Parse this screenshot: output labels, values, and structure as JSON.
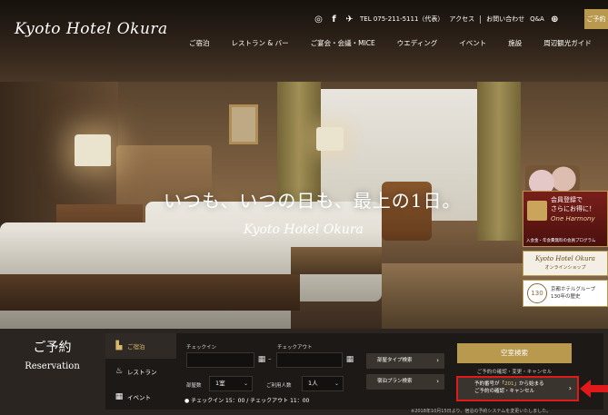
{
  "header": {
    "logo_text": "Kyoto Hotel Okura",
    "tel": "TEL 075-211-5111（代表）",
    "access": "アクセス",
    "contact": "お問い合わせ",
    "qa": "Q&A",
    "book_label": "ご予約"
  },
  "nav": [
    "ご宿泊",
    "レストラン & バー",
    "ご宴会・会議・MICE",
    "ウエディング",
    "イベント",
    "施設",
    "周辺観光ガイド"
  ],
  "hero": {
    "tagline": "いつも、いつの日も、最上の1日。",
    "tagline_sub": "Kyoto Hotel Okura"
  },
  "banners": {
    "member_line1": "会員登録で",
    "member_line2": "さらにお得に！",
    "member_line3": "One Harmony",
    "member_line4": "入会金・年会費無料の会員プログラム",
    "shop_line1": "Kyoto Hotel Okura",
    "shop_line2": "オンラインショップ",
    "group_seal": "130",
    "group_line1": "京都ホテルグループ",
    "group_line2": "130年の歴史"
  },
  "reservation": {
    "title_jp": "ご予約",
    "title_en": "Reservation",
    "tabs": [
      {
        "label": "ご宿泊",
        "icon": "bed-icon"
      },
      {
        "label": "レストラン",
        "icon": "dining-icon"
      },
      {
        "label": "イベント",
        "icon": "calendar-icon"
      }
    ],
    "checkin_label": "チェックイン",
    "checkout_label": "チェックアウト",
    "checkin_value": "",
    "checkout_value": "",
    "rooms_label": "部屋数",
    "rooms_value": "1室",
    "guests_label": "ご利用人数",
    "guests_value": "1人",
    "time_note": "● チェックイン 15：00 / チェックアウト 11：00",
    "room_type_btn": "部屋タイプ検索",
    "plan_btn": "宿泊プラン検索",
    "vacancy_btn": "空室検索",
    "confirm_link": "ご予約の確認・変更・キャンセル",
    "confirm_box_line1_a": "予約番号が「",
    "confirm_box_line1_hl": "201",
    "confirm_box_line1_b": "」から始まる",
    "confirm_box_line2": "ご予約の確認・キャンセル",
    "notice": "※2018年10月15日より、宿泊の予約システムを変更いたしました。"
  },
  "colors": {
    "gold": "#b8994e",
    "highlight_red": "#e01a1a",
    "panel_dark": "#1c1916"
  }
}
